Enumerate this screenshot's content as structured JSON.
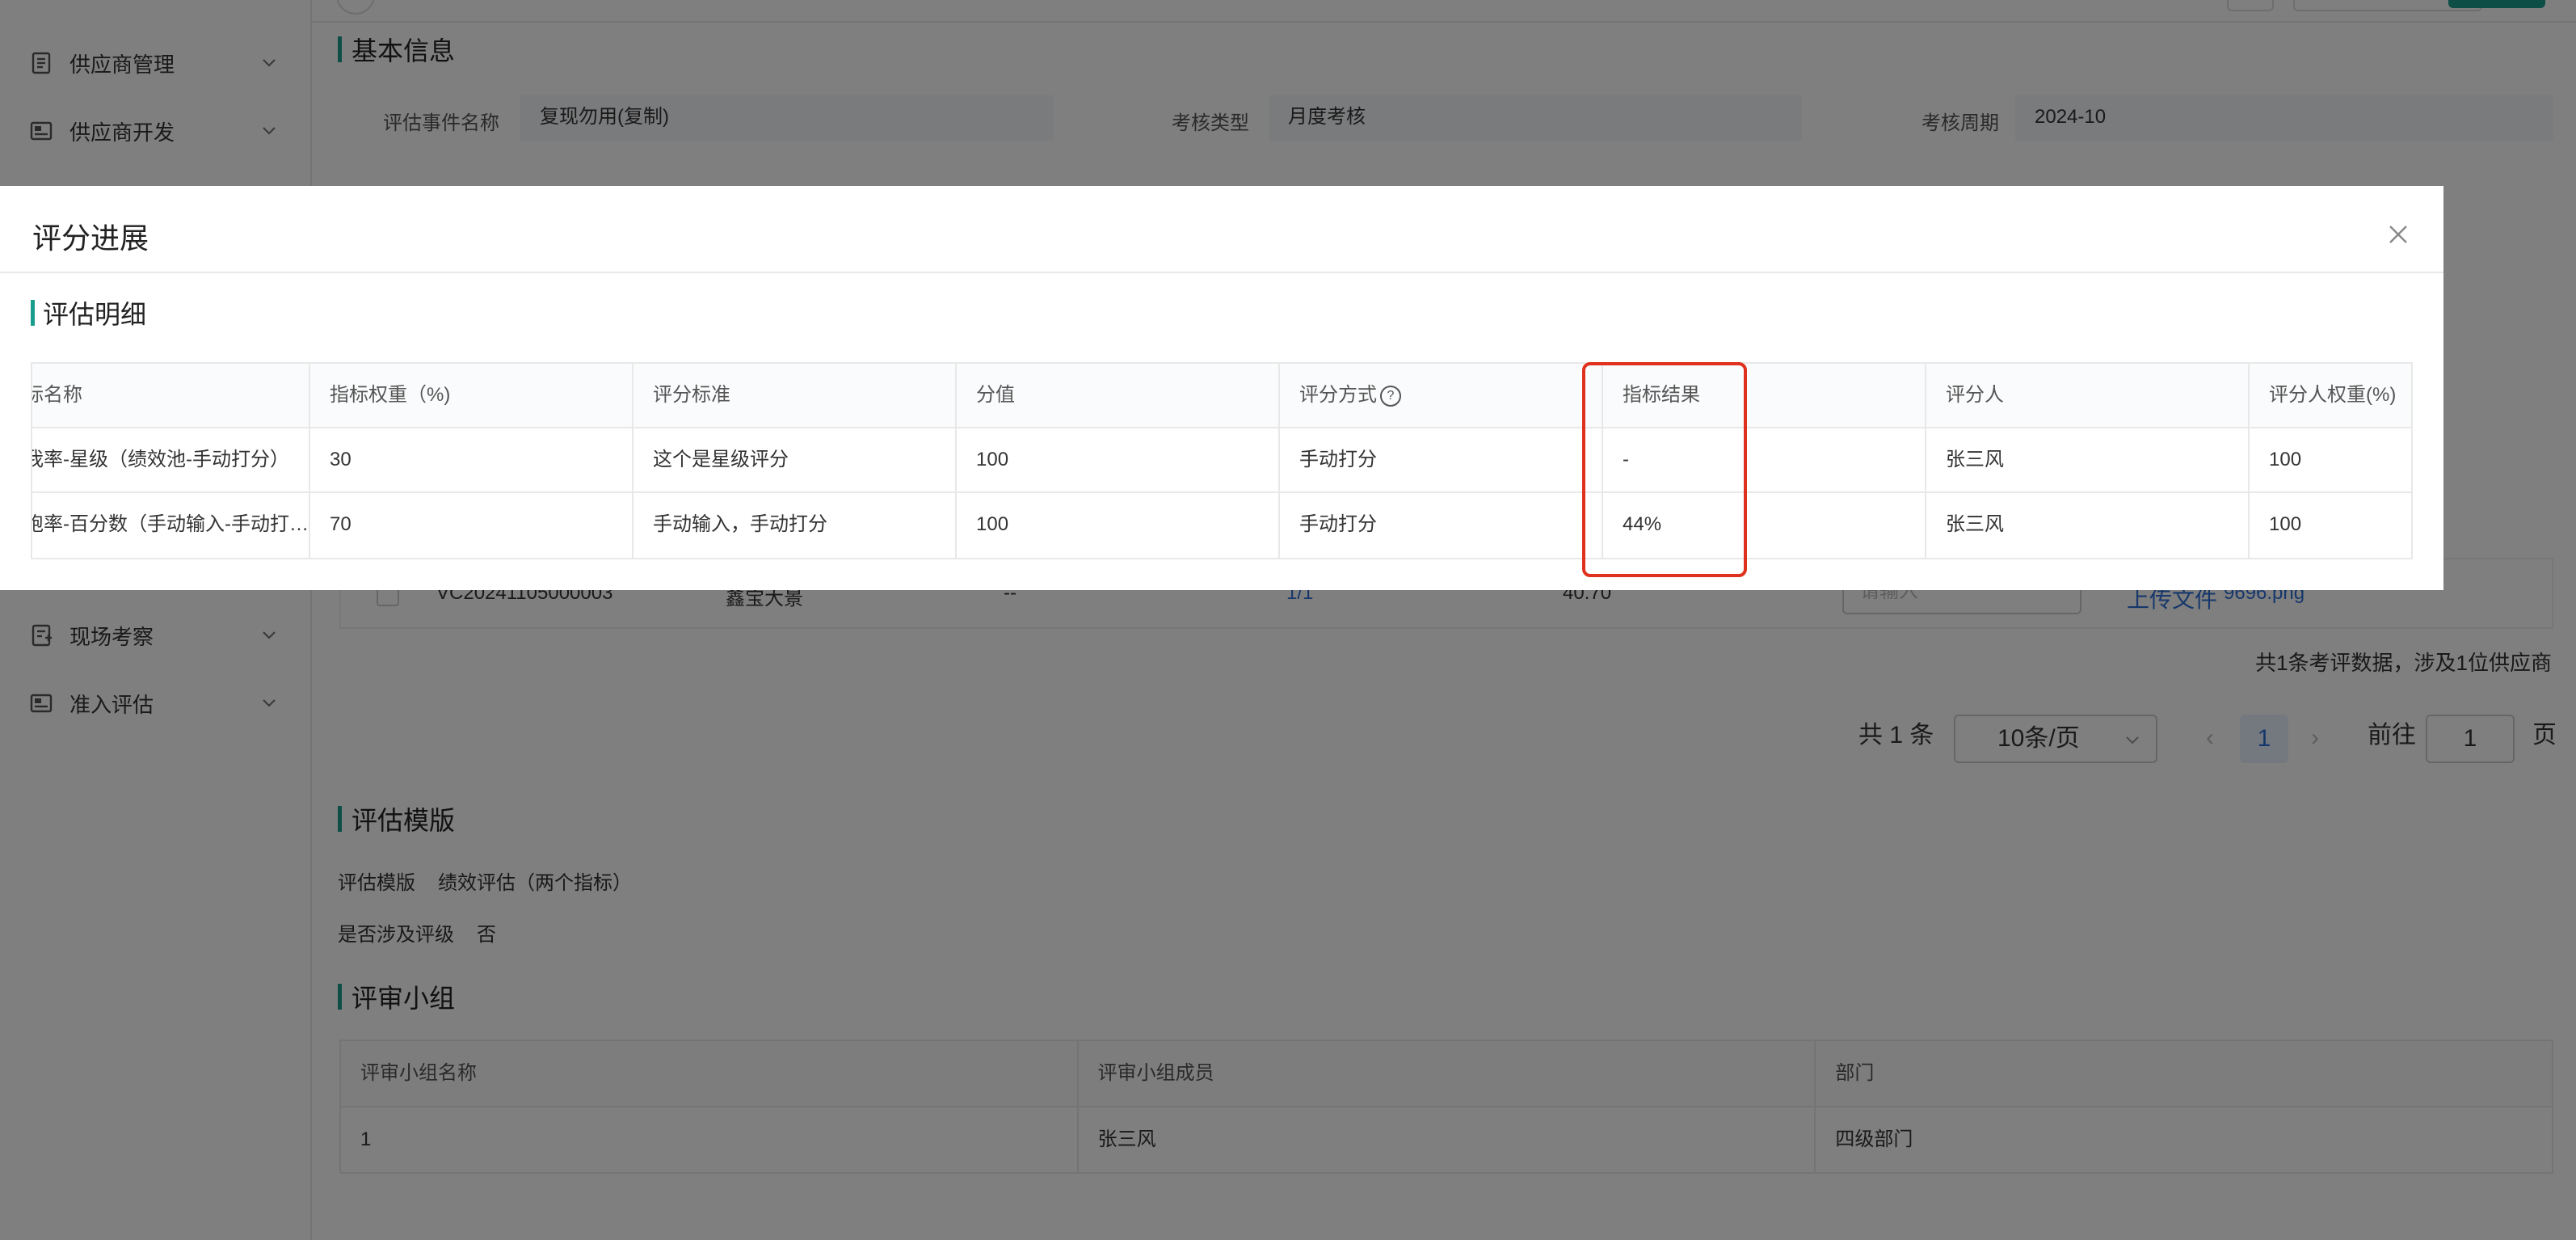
{
  "sidebar": {
    "items": [
      {
        "label": "供应商管理",
        "icon": "document-icon"
      },
      {
        "label": "供应商开发",
        "icon": "card-icon"
      },
      {
        "label": "现场考察",
        "icon": "checklist-icon"
      },
      {
        "label": "准入评估",
        "icon": "card-icon"
      }
    ]
  },
  "basic_info": {
    "title": "基本信息",
    "event_name_label": "评估事件名称",
    "event_name_value": "复现勿用(复制)",
    "assess_type_label": "考核类型",
    "assess_type_value": "月度考核",
    "period_label": "考核周期",
    "period_value": "2024-10"
  },
  "background_table": {
    "row": {
      "code": "VC20241105000003",
      "name": "鑫宝大景",
      "dash": "--",
      "ratio": "1/1",
      "score": "40.70",
      "input_placeholder": "请输入",
      "upload": "上传文件",
      "file": "9696.png"
    },
    "summary": "共1条考评数据，涉及1位供应商"
  },
  "pagination": {
    "total": "共 1 条",
    "page_size": "10条/页",
    "current": "1",
    "goto_label": "前往",
    "goto_value": "1",
    "page_suffix": "页"
  },
  "template_section": {
    "title": "评估模版",
    "template_label": "评估模版",
    "template_value": "绩效评估（两个指标）",
    "grading_label": "是否涉及评级",
    "grading_value": "否"
  },
  "review_group": {
    "title": "评审小组",
    "headers": [
      "评审小组名称",
      "评审小组成员",
      "部门"
    ],
    "rows": [
      [
        "1",
        "张三风",
        "四级部门"
      ]
    ]
  },
  "modal": {
    "title": "评分进展",
    "section_title": "评估明细",
    "headers": [
      "标名称",
      "指标权重（%)",
      "评分标准",
      "分值",
      "评分方式",
      "指标结果",
      "评分人",
      "评分人权重(%)"
    ],
    "rows": [
      [
        "我率-星级（绩效池-手动打分）",
        "30",
        "这个是星级评分",
        "100",
        "手动打分",
        "-",
        "张三风",
        "100"
      ],
      [
        "跑率-百分数（手动输入-手动打分）",
        "70",
        "手动输入，手动打分",
        "100",
        "手动打分",
        "44%",
        "张三风",
        "100"
      ]
    ]
  },
  "colors": {
    "accent": "#1a9c8d",
    "link": "#2d6fd6",
    "highlight": "#e0301e"
  }
}
